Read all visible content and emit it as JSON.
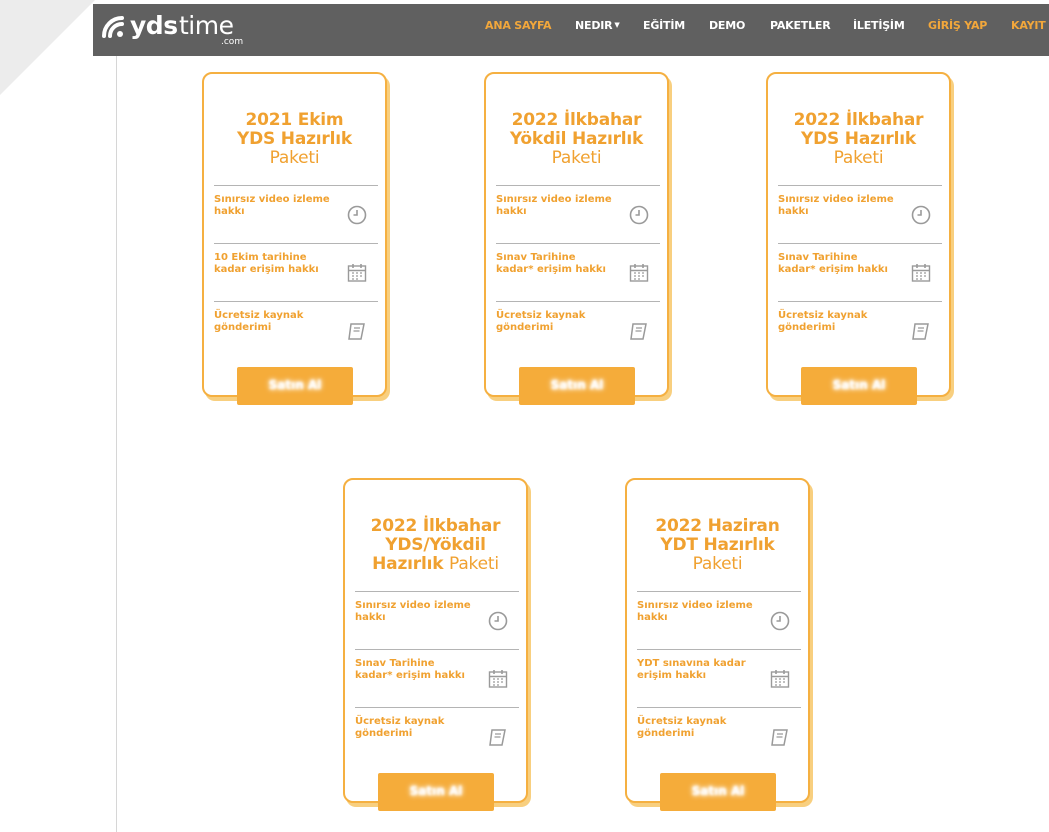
{
  "logo": {
    "main": "yds",
    "light": "time",
    "suffix": ".com"
  },
  "nav": [
    {
      "label": "ANA SAYFA",
      "active": true
    },
    {
      "label": "NEDIR",
      "dropdown": true
    },
    {
      "label": "EĞİTİM"
    },
    {
      "label": "DEMO"
    },
    {
      "label": "PAKETLER"
    },
    {
      "label": "İLETİŞİM"
    },
    {
      "label": "GİRİŞ YAP",
      "highlight": true
    },
    {
      "label": "KAYIT O",
      "highlight": true
    }
  ],
  "cards": [
    {
      "title_bold_1": "2021 Ekim",
      "title_bold_2": "YDS Hazırlık",
      "title_light": "Paketi",
      "features": [
        {
          "text": "Sınırsız video izleme hakkı",
          "icon": "clock-icon"
        },
        {
          "text": "10 Ekim tarihine kadar erişim hakkı",
          "icon": "calendar-icon"
        },
        {
          "text": "Ücretsiz kaynak gönderimi",
          "icon": "book-icon"
        }
      ],
      "button": "Satın Al"
    },
    {
      "title_bold_1": "2022 İlkbahar",
      "title_bold_2": "Yökdil Hazırlık",
      "title_light": "Paketi",
      "features": [
        {
          "text": "Sınırsız video izleme hakkı",
          "icon": "clock-icon"
        },
        {
          "text": "Sınav Tarihine kadar* erişim hakkı",
          "icon": "calendar-icon"
        },
        {
          "text": "Ücretsiz kaynak gönderimi",
          "icon": "book-icon"
        }
      ],
      "button": "Satın Al"
    },
    {
      "title_bold_1": "2022 İlkbahar",
      "title_bold_2": "YDS Hazırlık",
      "title_light": "Paketi",
      "features": [
        {
          "text": "Sınırsız video izleme hakkı",
          "icon": "clock-icon"
        },
        {
          "text": "Sınav Tarihine kadar* erişim hakkı",
          "icon": "calendar-icon"
        },
        {
          "text": "Ücretsiz kaynak gönderimi",
          "icon": "book-icon"
        }
      ],
      "button": "Satın Al"
    },
    {
      "title_bold_1": "2022 İlkbahar",
      "title_bold_2": "YDS/Yökdil",
      "title_bold_3": "Hazırlık",
      "title_light": "Paketi",
      "features": [
        {
          "text": "Sınırsız video izleme hakkı",
          "icon": "clock-icon"
        },
        {
          "text": "Sınav Tarihine kadar* erişim hakkı",
          "icon": "calendar-icon"
        },
        {
          "text": "Ücretsiz kaynak gönderimi",
          "icon": "book-icon"
        }
      ],
      "button": "Satın Al"
    },
    {
      "title_bold_1": "2022 Haziran",
      "title_bold_2": "YDT Hazırlık",
      "title_light": "Paketi",
      "features": [
        {
          "text": "Sınırsız video izleme hakkı",
          "icon": "clock-icon"
        },
        {
          "text": "YDT sınavına kadar erişim hakkı",
          "icon": "calendar-icon"
        },
        {
          "text": "Ücretsiz kaynak gönderimi",
          "icon": "book-icon"
        }
      ],
      "button": "Satın Al"
    }
  ],
  "colors": {
    "accent": "#f0a130",
    "button": "#f5ac3a",
    "header": "#606060"
  }
}
